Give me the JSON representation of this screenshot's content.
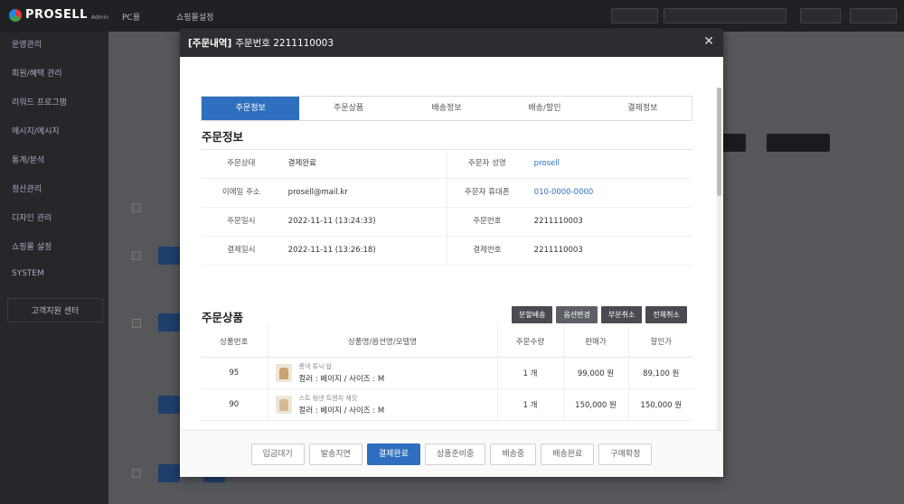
{
  "app": {
    "logo_text": "PROSELL",
    "logo_sub": "Admin",
    "top_links": [
      "PC용",
      "쇼핑몰설정"
    ]
  },
  "sidebar": {
    "items": [
      "운영관리",
      "회원/혜택 관리",
      "리워드 프로그램",
      "메시지/메시지",
      "통계/분석",
      "정산관리",
      "디자인 관리",
      "쇼핑몰 설정",
      "SYSTEM"
    ],
    "support_label": "고객지원 센터"
  },
  "modal": {
    "title_tag": "[주문내역]",
    "title": "주문번호 2211110003",
    "tabs": [
      {
        "label": "주문정보",
        "active": true
      },
      {
        "label": "주문상품",
        "active": false
      },
      {
        "label": "배송정보",
        "active": false
      },
      {
        "label": "배송/할인",
        "active": false
      },
      {
        "label": "결제정보",
        "active": false
      }
    ],
    "order_info": {
      "title": "주문정보",
      "rows": [
        {
          "l1": "주문상태",
          "v1": "결제완료",
          "l2": "주문자 성명",
          "v2": "prosell"
        },
        {
          "l1": "이메일 주소",
          "v1": "prosell@mail.kr",
          "l2": "주문자 휴대폰",
          "v2": "010-0000-0000"
        },
        {
          "l1": "주문일시",
          "v1": "2022-11-11 (13:24:33)",
          "l2": "주문번호",
          "v2": "2211110003"
        },
        {
          "l1": "결제일시",
          "v1": "2022-11-11 (13:26:18)",
          "l2": "결제번호",
          "v2": "2211110003"
        }
      ]
    },
    "products": {
      "title": "주문상품",
      "buttons": [
        "분할배송",
        "옵션변경",
        "부분취소",
        "전체취소"
      ],
      "headers": [
        "상품번호",
        "상품명/옵션명/모델명",
        "주문수량",
        "판매가",
        "할인가"
      ],
      "rows": [
        {
          "no": "95",
          "name": "롱넥 튜닉 탑",
          "option": "컬러 : 베이지 / 사이즈 : M",
          "qty": "1 개",
          "price": "99,000 원",
          "sale": "89,100 원"
        },
        {
          "no": "90",
          "name": "스트 링넨 트렌치 재킷",
          "option": "컬러 : 베이지 / 사이즈 : M",
          "qty": "1 개",
          "price": "150,000 원",
          "sale": "150,000 원"
        }
      ]
    },
    "status_buttons": [
      {
        "label": "입금대기",
        "active": false
      },
      {
        "label": "발송지연",
        "active": false
      },
      {
        "label": "결제완료",
        "active": true
      },
      {
        "label": "상품준비중",
        "active": false
      },
      {
        "label": "배송중",
        "active": false
      },
      {
        "label": "배송완료",
        "active": false
      },
      {
        "label": "구매확정",
        "active": false
      }
    ]
  }
}
